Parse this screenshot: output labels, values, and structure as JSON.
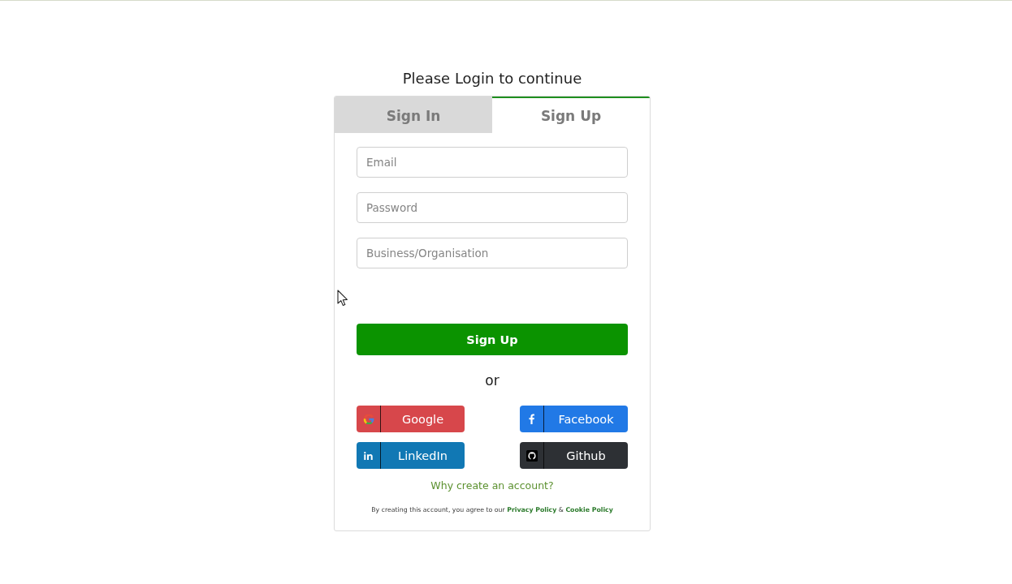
{
  "heading": "Please Login to continue",
  "tabs": [
    {
      "label": "Sign In",
      "selected": false
    },
    {
      "label": "Sign Up",
      "selected": true
    }
  ],
  "fields": [
    {
      "placeholder": "Email"
    },
    {
      "placeholder": "Password"
    },
    {
      "placeholder": "Business/Organisation"
    }
  ],
  "submit_button": "Sign Up",
  "divider_text": "or",
  "social_buttons": [
    {
      "kind": "google",
      "label": "Google",
      "color": "#d7474b"
    },
    {
      "kind": "facebook",
      "label": "Facebook",
      "color": "#2179e6"
    },
    {
      "kind": "linkedin",
      "label": "LinkedIn",
      "color": "#1178b4"
    },
    {
      "kind": "github",
      "label": "Github",
      "color": "#2d3034"
    }
  ],
  "why_link": "Why create an account?",
  "terms": {
    "text": "By creating this account, you agree to our",
    "privacy_link": "Privacy Policy",
    "separator": "&",
    "cookie_link": "Cookie Policy"
  }
}
